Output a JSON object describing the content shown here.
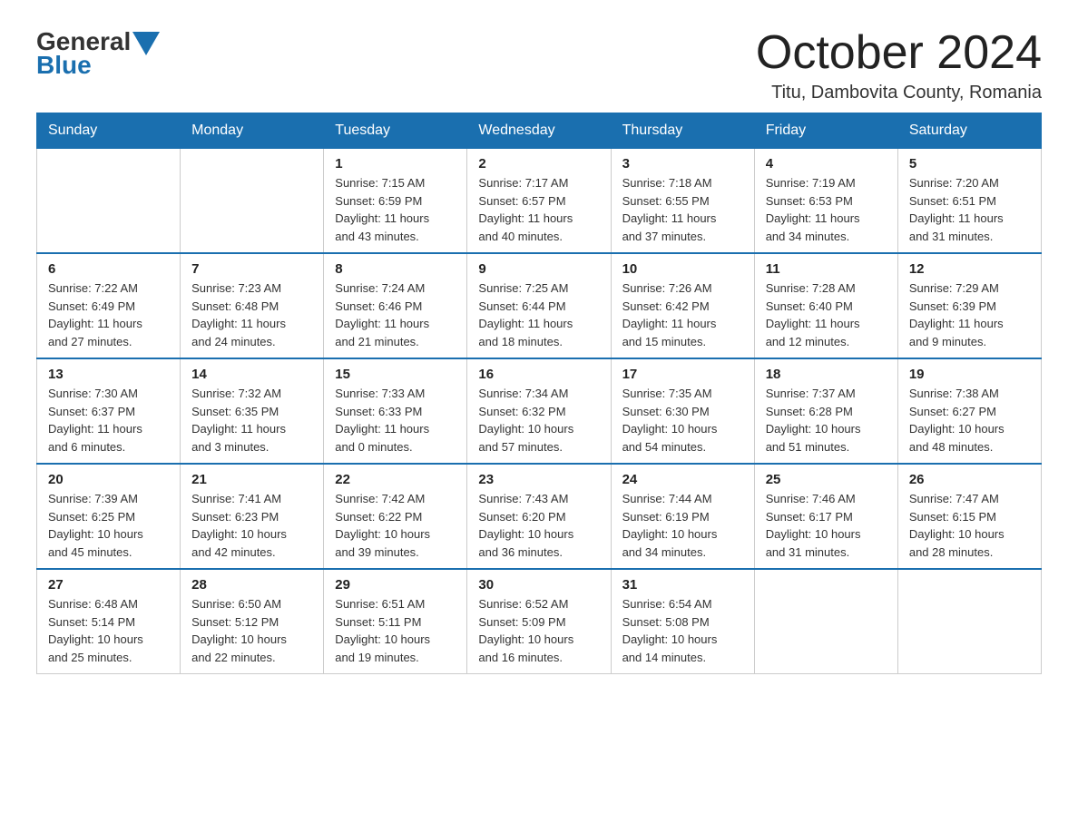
{
  "logo": {
    "general": "General",
    "blue": "Blue"
  },
  "title": "October 2024",
  "location": "Titu, Dambovita County, Romania",
  "headers": [
    "Sunday",
    "Monday",
    "Tuesday",
    "Wednesday",
    "Thursday",
    "Friday",
    "Saturday"
  ],
  "weeks": [
    [
      {
        "day": "",
        "info": ""
      },
      {
        "day": "",
        "info": ""
      },
      {
        "day": "1",
        "info": "Sunrise: 7:15 AM\nSunset: 6:59 PM\nDaylight: 11 hours\nand 43 minutes."
      },
      {
        "day": "2",
        "info": "Sunrise: 7:17 AM\nSunset: 6:57 PM\nDaylight: 11 hours\nand 40 minutes."
      },
      {
        "day": "3",
        "info": "Sunrise: 7:18 AM\nSunset: 6:55 PM\nDaylight: 11 hours\nand 37 minutes."
      },
      {
        "day": "4",
        "info": "Sunrise: 7:19 AM\nSunset: 6:53 PM\nDaylight: 11 hours\nand 34 minutes."
      },
      {
        "day": "5",
        "info": "Sunrise: 7:20 AM\nSunset: 6:51 PM\nDaylight: 11 hours\nand 31 minutes."
      }
    ],
    [
      {
        "day": "6",
        "info": "Sunrise: 7:22 AM\nSunset: 6:49 PM\nDaylight: 11 hours\nand 27 minutes."
      },
      {
        "day": "7",
        "info": "Sunrise: 7:23 AM\nSunset: 6:48 PM\nDaylight: 11 hours\nand 24 minutes."
      },
      {
        "day": "8",
        "info": "Sunrise: 7:24 AM\nSunset: 6:46 PM\nDaylight: 11 hours\nand 21 minutes."
      },
      {
        "day": "9",
        "info": "Sunrise: 7:25 AM\nSunset: 6:44 PM\nDaylight: 11 hours\nand 18 minutes."
      },
      {
        "day": "10",
        "info": "Sunrise: 7:26 AM\nSunset: 6:42 PM\nDaylight: 11 hours\nand 15 minutes."
      },
      {
        "day": "11",
        "info": "Sunrise: 7:28 AM\nSunset: 6:40 PM\nDaylight: 11 hours\nand 12 minutes."
      },
      {
        "day": "12",
        "info": "Sunrise: 7:29 AM\nSunset: 6:39 PM\nDaylight: 11 hours\nand 9 minutes."
      }
    ],
    [
      {
        "day": "13",
        "info": "Sunrise: 7:30 AM\nSunset: 6:37 PM\nDaylight: 11 hours\nand 6 minutes."
      },
      {
        "day": "14",
        "info": "Sunrise: 7:32 AM\nSunset: 6:35 PM\nDaylight: 11 hours\nand 3 minutes."
      },
      {
        "day": "15",
        "info": "Sunrise: 7:33 AM\nSunset: 6:33 PM\nDaylight: 11 hours\nand 0 minutes."
      },
      {
        "day": "16",
        "info": "Sunrise: 7:34 AM\nSunset: 6:32 PM\nDaylight: 10 hours\nand 57 minutes."
      },
      {
        "day": "17",
        "info": "Sunrise: 7:35 AM\nSunset: 6:30 PM\nDaylight: 10 hours\nand 54 minutes."
      },
      {
        "day": "18",
        "info": "Sunrise: 7:37 AM\nSunset: 6:28 PM\nDaylight: 10 hours\nand 51 minutes."
      },
      {
        "day": "19",
        "info": "Sunrise: 7:38 AM\nSunset: 6:27 PM\nDaylight: 10 hours\nand 48 minutes."
      }
    ],
    [
      {
        "day": "20",
        "info": "Sunrise: 7:39 AM\nSunset: 6:25 PM\nDaylight: 10 hours\nand 45 minutes."
      },
      {
        "day": "21",
        "info": "Sunrise: 7:41 AM\nSunset: 6:23 PM\nDaylight: 10 hours\nand 42 minutes."
      },
      {
        "day": "22",
        "info": "Sunrise: 7:42 AM\nSunset: 6:22 PM\nDaylight: 10 hours\nand 39 minutes."
      },
      {
        "day": "23",
        "info": "Sunrise: 7:43 AM\nSunset: 6:20 PM\nDaylight: 10 hours\nand 36 minutes."
      },
      {
        "day": "24",
        "info": "Sunrise: 7:44 AM\nSunset: 6:19 PM\nDaylight: 10 hours\nand 34 minutes."
      },
      {
        "day": "25",
        "info": "Sunrise: 7:46 AM\nSunset: 6:17 PM\nDaylight: 10 hours\nand 31 minutes."
      },
      {
        "day": "26",
        "info": "Sunrise: 7:47 AM\nSunset: 6:15 PM\nDaylight: 10 hours\nand 28 minutes."
      }
    ],
    [
      {
        "day": "27",
        "info": "Sunrise: 6:48 AM\nSunset: 5:14 PM\nDaylight: 10 hours\nand 25 minutes."
      },
      {
        "day": "28",
        "info": "Sunrise: 6:50 AM\nSunset: 5:12 PM\nDaylight: 10 hours\nand 22 minutes."
      },
      {
        "day": "29",
        "info": "Sunrise: 6:51 AM\nSunset: 5:11 PM\nDaylight: 10 hours\nand 19 minutes."
      },
      {
        "day": "30",
        "info": "Sunrise: 6:52 AM\nSunset: 5:09 PM\nDaylight: 10 hours\nand 16 minutes."
      },
      {
        "day": "31",
        "info": "Sunrise: 6:54 AM\nSunset: 5:08 PM\nDaylight: 10 hours\nand 14 minutes."
      },
      {
        "day": "",
        "info": ""
      },
      {
        "day": "",
        "info": ""
      }
    ]
  ]
}
